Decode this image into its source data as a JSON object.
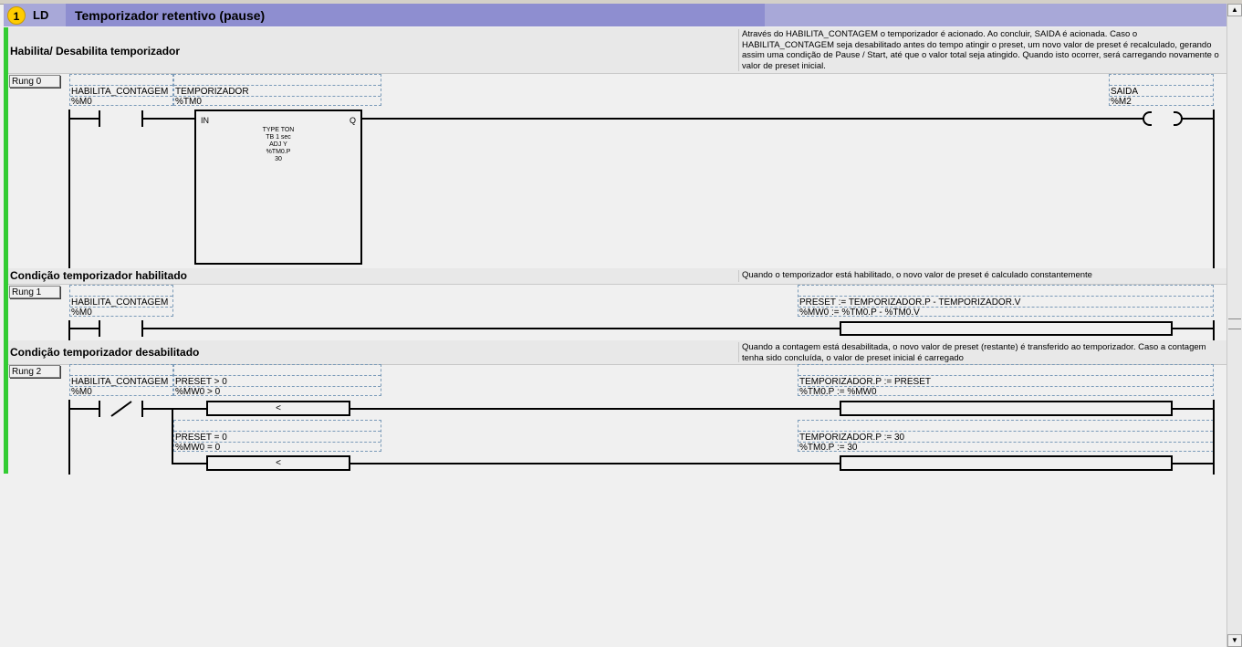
{
  "header": {
    "number": "1",
    "language": "LD",
    "title": "Temporizador retentivo (pause)"
  },
  "sections": [
    {
      "title": "Habilita/ Desabilita temporizador",
      "description": "Através do HABILITA_CONTAGEM o temporizador é acionado. Ao  concluir, SAIDA é acionada. Caso o HABILITA_CONTAGEM seja desabilitado antes do tempo atingir o preset, um novo valor de preset é recalculado, gerando assim uma condição de Pause / Start, até que o valor total seja atingido. Quando isto ocorrer, será carregando novamente o valor de preset inicial."
    },
    {
      "title": "Condição temporizador habilitado",
      "description": "Quando o temporizador está habilitado, o novo valor de preset é calculado constantemente"
    },
    {
      "title": "Condição temporizador desabilitado",
      "description": "Quando a contagem está desabilitada, o novo valor de preset (restante) é transferido ao temporizador. Caso a contagem tenha sido concluída, o valor de preset inicial é carregado"
    }
  ],
  "rungs": [
    {
      "label": "Rung 0",
      "contact": {
        "symbol": "HABILITA_CONTAGEM",
        "address": "%M0"
      },
      "timer": {
        "symbol": "TEMPORIZADOR",
        "address": "%TM0",
        "in": "IN",
        "q": "Q",
        "params": [
          "TYPE   TON",
          "TB      1 sec",
          "ADJ      Y",
          "%TM0.P",
          "30"
        ]
      },
      "coil": {
        "symbol": "SAIDA",
        "address": "%M2"
      }
    },
    {
      "label": "Rung 1",
      "contact": {
        "symbol": "HABILITA_CONTAGEM",
        "address": "%M0"
      },
      "operate": {
        "symbol": "PRESET  := TEMPORIZADOR.P - TEMPORIZADOR.V",
        "address": "%MW0  := %TM0.P - %TM0.V"
      }
    },
    {
      "label": "Rung 2",
      "contact": {
        "symbol": "HABILITA_CONTAGEM",
        "address": "%M0"
      },
      "compare1": {
        "symbol": "PRESET > 0",
        "address": "%MW0 > 0",
        "op": "<"
      },
      "operate1": {
        "symbol": "TEMPORIZADOR.P  := PRESET",
        "address": "%TM0.P  := %MW0"
      },
      "compare2": {
        "symbol": "PRESET = 0",
        "address": "%MW0 = 0",
        "op": "<"
      },
      "operate2": {
        "symbol": "TEMPORIZADOR.P  := 30",
        "address": "%TM0.P  := 30"
      }
    }
  ],
  "scrollbar": {
    "up": "▲",
    "down": "▼"
  }
}
